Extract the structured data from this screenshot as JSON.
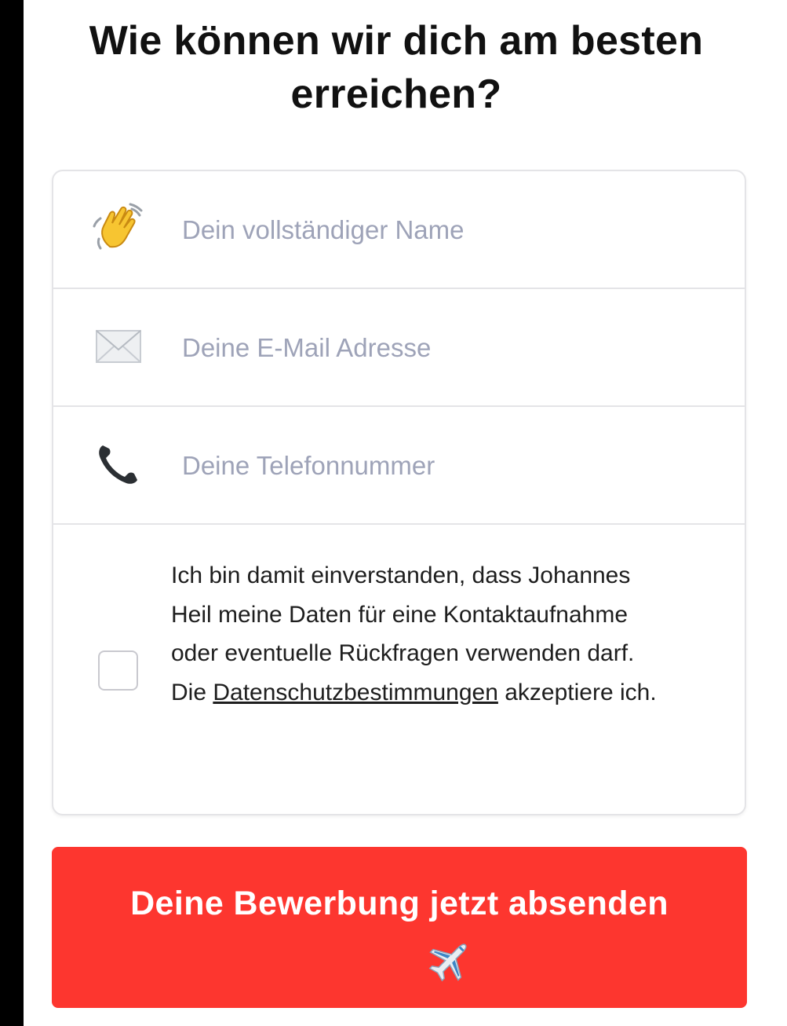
{
  "form": {
    "heading": "Wie können wir dich am besten erreichen?",
    "fields": [
      {
        "icon": "waving-hand-icon",
        "placeholder": "Dein vollständiger Name",
        "value": ""
      },
      {
        "icon": "envelope-icon",
        "placeholder": "Deine E-Mail Adresse",
        "value": ""
      },
      {
        "icon": "telephone-icon",
        "placeholder": "Deine Telefonnummer",
        "value": ""
      }
    ],
    "consent": {
      "checked": false,
      "text_before": "Ich bin damit einverstanden, dass Johannes Heil meine Daten für eine Kontaktaufnahme oder eventuelle Rückfragen verwenden darf. Die",
      "link_label": "Datenschutzbestimmungen",
      "text_after": "akzeptiere ich."
    },
    "submit": {
      "label": "Deine Bewerbung jetzt absenden",
      "icon": "airplane-icon"
    }
  },
  "colors": {
    "button_background": "#fd362f",
    "placeholder": "#9ea3b8",
    "border": "#e4e4e7",
    "heading_text": "#111111"
  }
}
